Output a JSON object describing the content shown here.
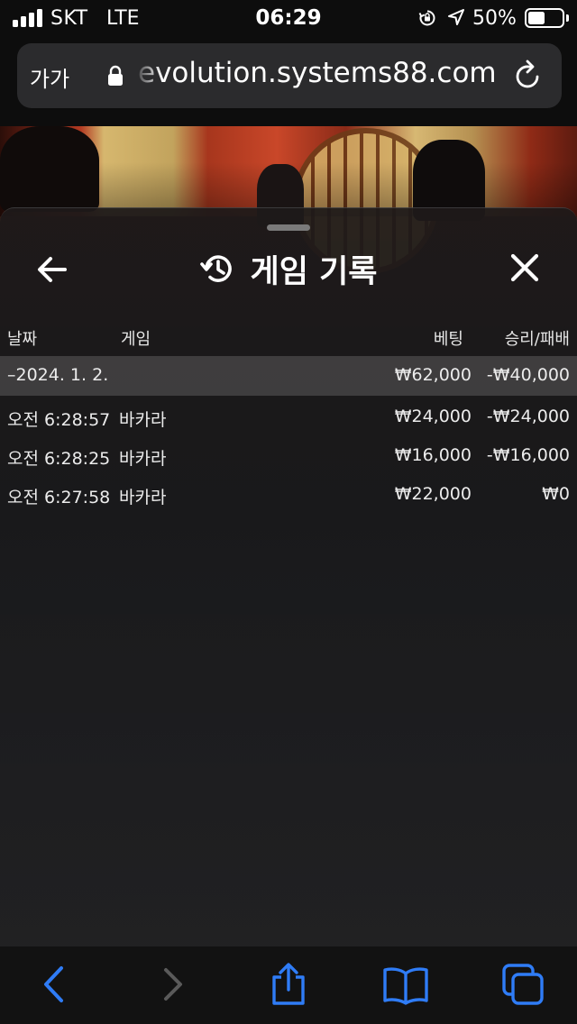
{
  "status_bar": {
    "carrier": "SKT",
    "network": "LTE",
    "time": "06:29",
    "battery_percent": "50%",
    "battery_level": 0.5,
    "icons": [
      "signal-bars-icon",
      "rotation-lock-icon",
      "location-arrow-icon",
      "battery-icon"
    ]
  },
  "address_bar": {
    "text_size_button": "가가",
    "url": "evolution.systems88.com",
    "icons": [
      "lock-icon",
      "reload-icon"
    ]
  },
  "panel": {
    "title": "게임 기록",
    "icons": [
      "back-arrow-icon",
      "history-icon",
      "close-icon"
    ],
    "columns": {
      "date": "날짜",
      "game": "게임",
      "bet": "베팅",
      "win_loss": "승리/패배"
    },
    "summary": {
      "date": "–2024. 1. 2.",
      "bet": "₩62,000",
      "win_loss": "-₩40,000"
    },
    "rows": [
      {
        "time": "오전 6:28:57",
        "game": "바카라",
        "bet": "₩24,000",
        "win_loss": "-₩24,000"
      },
      {
        "time": "오전 6:28:25",
        "game": "바카라",
        "bet": "₩16,000",
        "win_loss": "-₩16,000"
      },
      {
        "time": "오전 6:27:58",
        "game": "바카라",
        "bet": "₩22,000",
        "win_loss": "₩0"
      }
    ]
  },
  "toolbar": {
    "icons": [
      "back-icon",
      "forward-icon",
      "share-icon",
      "bookmarks-icon",
      "tabs-icon"
    ],
    "accent_color": "#2f7cf6",
    "disabled_color": "#5a5a5a"
  }
}
